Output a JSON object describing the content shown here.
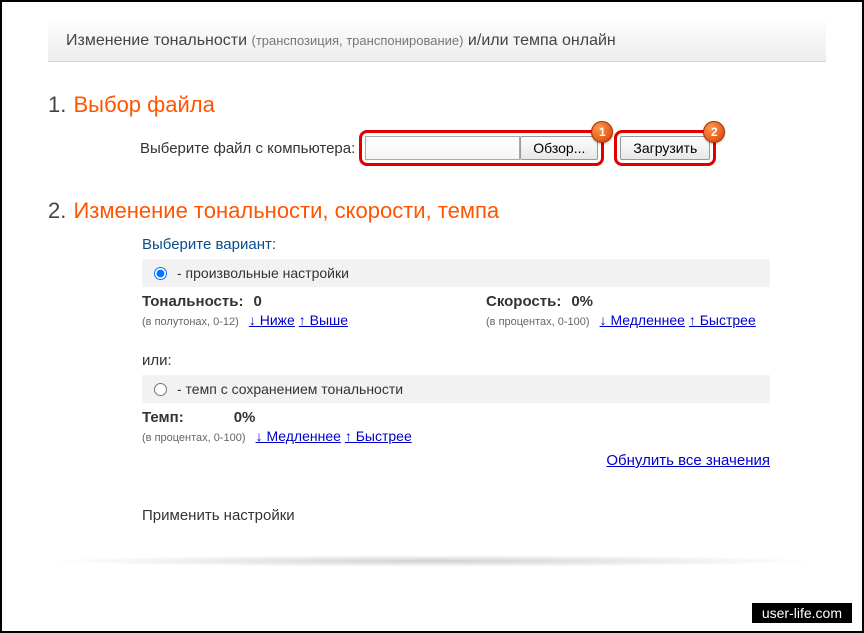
{
  "header": {
    "prefix": "Изменение тональности ",
    "paren": "(транспозиция, транспонирование)",
    "suffix": " и/или темпа онлайн"
  },
  "step1": {
    "num": "1.",
    "title": "Выбор файла",
    "label": "Выберите файл с компьютера:",
    "browse": "Обзор...",
    "upload": "Загрузить",
    "badge1": "1",
    "badge2": "2"
  },
  "step2": {
    "num": "2.",
    "title": "Изменение тональности, скорости, темпа",
    "choose": "Выберите вариант:",
    "opt_free": "- произвольные настройки",
    "tonality": {
      "name": "Тональность:",
      "value": "0",
      "sub": "(в полутонах, 0-12)",
      "lower": "↓ Ниже",
      "higher": "↑ Выше"
    },
    "speed": {
      "name": "Скорость:",
      "value": "0%",
      "sub": "(в процентах, 0-100)",
      "slower": "↓ Медленнее",
      "faster": "↑ Быстрее"
    },
    "or": "или:",
    "opt_tempo": "- темп с сохранением тональности",
    "tempo": {
      "name": "Темп:",
      "value": "0%",
      "sub": "(в процентах, 0-100)",
      "slower": "↓ Медленнее",
      "faster": "↑ Быстрее"
    },
    "reset": "Обнулить все значения",
    "apply": "Применить настройки"
  },
  "watermark": "user-life.com"
}
